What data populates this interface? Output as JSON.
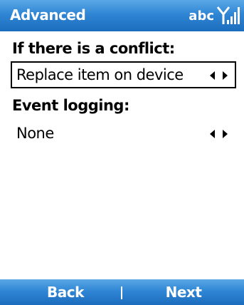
{
  "title_bar": {
    "title": "Advanced",
    "input_mode": "abc",
    "signal_icon": "signal-strength-icon"
  },
  "conflict": {
    "label": "If there is a conflict:",
    "value": "Replace item on device",
    "left_arrow_icon": "arrow-left-icon",
    "right_arrow_icon": "arrow-right-icon"
  },
  "logging": {
    "label": "Event logging:",
    "value": "None",
    "left_arrow_icon": "arrow-left-icon",
    "right_arrow_icon": "arrow-right-icon"
  },
  "softkeys": {
    "left": "Back",
    "right": "Next"
  },
  "colors": {
    "bar_top": "#5aa7e6",
    "bar_bottom": "#1c6cbd",
    "text": "#000000",
    "background": "#ffffff"
  }
}
